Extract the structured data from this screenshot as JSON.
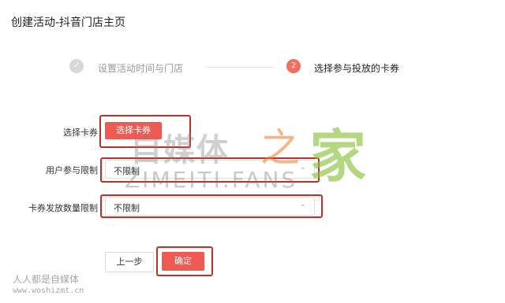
{
  "page": {
    "title": "创建活动-抖音门店主页"
  },
  "steps": [
    {
      "number": "✓",
      "label": "设置活动时间与门店",
      "state": "done"
    },
    {
      "number": "2",
      "label": "选择参与投放的卡券",
      "state": "active"
    }
  ],
  "form": {
    "coupon_label": "选择卡券",
    "coupon_button": "选择卡券",
    "user_limit_label": "用户参与限制",
    "user_limit_value": "不限制",
    "issue_limit_label": "卡券发放数量限制",
    "issue_limit_value": "不限制"
  },
  "actions": {
    "prev": "上一步",
    "confirm": "确定"
  },
  "watermark": {
    "main": "自媒体",
    "zhi": "之",
    "jia": "家",
    "en": "ZIMEITI.FANS",
    "bottom1": "人人都是自媒体",
    "bottom2": "www.woshizmt.cn"
  },
  "colors": {
    "accent": "#ee5b55",
    "highlight_border": "#c0302a",
    "done_step": "#d8d8d8"
  }
}
